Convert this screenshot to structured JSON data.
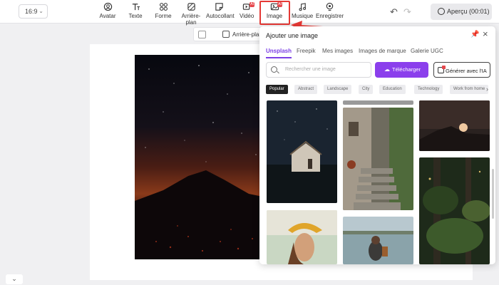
{
  "toolbar": {
    "ratio": "16:9",
    "tools": [
      {
        "label": "Avatar",
        "icon": "avatar-icon"
      },
      {
        "label": "Texte",
        "icon": "text-icon"
      },
      {
        "label": "Forme",
        "icon": "shape-icon"
      },
      {
        "label": "Arrière-plan",
        "icon": "background-icon"
      },
      {
        "label": "Autocollant",
        "icon": "sticker-icon"
      },
      {
        "label": "Vidéo",
        "icon": "video-icon",
        "badge": "AI"
      },
      {
        "label": "Image",
        "icon": "image-icon",
        "badge": "AI",
        "active": true
      },
      {
        "label": "Musique",
        "icon": "music-icon"
      },
      {
        "label": "Enregistrer",
        "icon": "record-icon"
      }
    ],
    "preview": "Aperçu (00:01)"
  },
  "subbar": {
    "background_label": "Arrière-plan"
  },
  "panel": {
    "title": "Ajouter une image",
    "tabs": [
      "Unsplash",
      "Freepik",
      "Mes images",
      "Images de marque",
      "Galerie UGC"
    ],
    "active_tab": "Unsplash",
    "search_placeholder": "Rechercher une image",
    "upload_label": "Télécharger",
    "ai_label": "Générer avec l'IA",
    "chips": [
      "Popular",
      "Abstract",
      "Landscape",
      "City",
      "Education",
      "Technology",
      "Work from home"
    ]
  },
  "colors": {
    "accent": "#8b3fec",
    "highlight": "#e53935"
  }
}
